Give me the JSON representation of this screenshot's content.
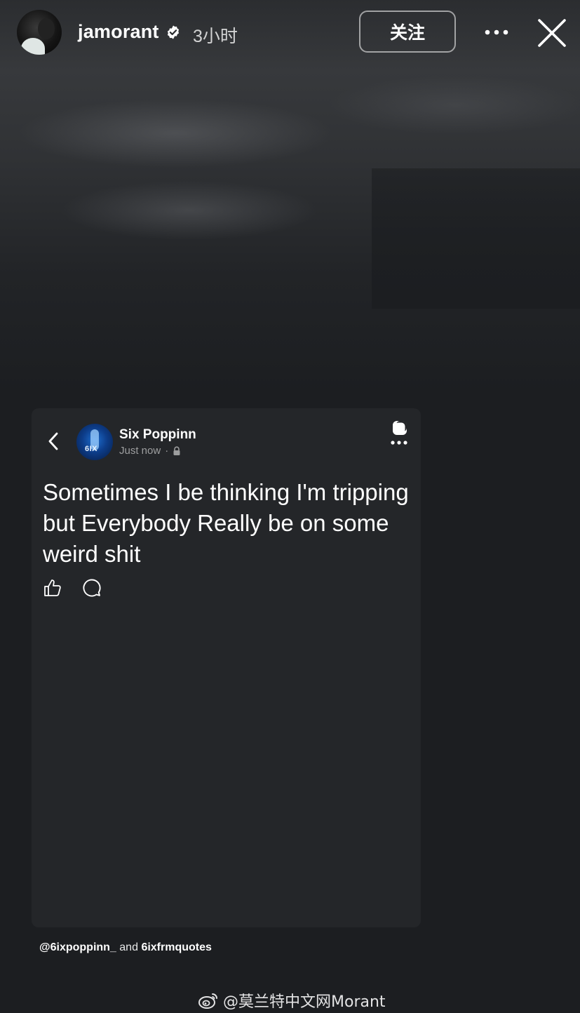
{
  "story": {
    "username": "jamorant",
    "time_ago": "3小时",
    "follow_label": "关注"
  },
  "card": {
    "author_name": "Six Poppinn",
    "posted": "Just now",
    "separator": "·",
    "post_text": "Sometimes I be thinking I'm tripping but Everybody Really be on some weird shit",
    "avatar_label": "6IX"
  },
  "credits": {
    "handle1": "@6ixpoppinn_",
    "joiner": "and",
    "handle2": "6ixfrmquotes"
  },
  "watermark": {
    "text": "@莫兰特中文网Morant"
  },
  "icons": {
    "verified": "verified-badge-icon",
    "more": "more-horizontal-icon",
    "close": "close-icon",
    "back": "chevron-left-icon",
    "lock": "lock-icon",
    "card_menu": "threads-menu-icon",
    "like": "thumbs-up-icon",
    "comment": "comment-icon",
    "weibo": "weibo-logo-icon"
  },
  "colors": {
    "background": "#1c1e21",
    "card": "#242629",
    "text": "#ffffff"
  }
}
